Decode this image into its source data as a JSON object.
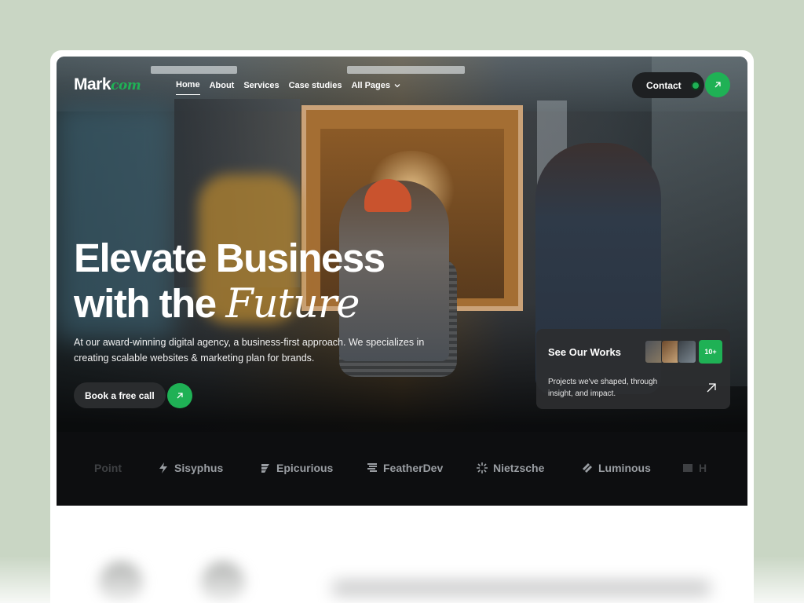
{
  "brand": {
    "logo_main": "Mark",
    "logo_accent": "com"
  },
  "nav": {
    "items": [
      {
        "label": "Home",
        "active": true
      },
      {
        "label": "About"
      },
      {
        "label": "Services"
      },
      {
        "label": "Case studies"
      },
      {
        "label": "All Pages",
        "has_dropdown": true
      }
    ],
    "contact_label": "Contact"
  },
  "hero": {
    "headline_line1": "Elevate Business",
    "headline_line2_prefix": "with the ",
    "headline_line2_accent": "Future",
    "subtext": "At our award-winning digital agency, a business-first approach. We specializes in creating scalable websites & marketing plan for brands.",
    "cta_label": "Book a free call"
  },
  "works_card": {
    "title": "See Our Works",
    "badge": "10+",
    "description": "Projects we've shaped, through insight, and impact."
  },
  "partners": [
    {
      "name": "Point",
      "icon": "point-logo-icon",
      "faded": true
    },
    {
      "name": "Sisyphus",
      "icon": "sisyphus-logo-icon"
    },
    {
      "name": "Epicurious",
      "icon": "epicurious-logo-icon"
    },
    {
      "name": "FeatherDev",
      "icon": "featherdev-logo-icon"
    },
    {
      "name": "Nietzsche",
      "icon": "nietzsche-logo-icon"
    },
    {
      "name": "Luminous",
      "icon": "luminous-logo-icon"
    },
    {
      "name": "H",
      "icon": "partial-logo-icon",
      "faded": true
    }
  ],
  "colors": {
    "accent": "#1fb155",
    "dark": "#0d0e10",
    "page_bg": "#c9d6c4"
  }
}
